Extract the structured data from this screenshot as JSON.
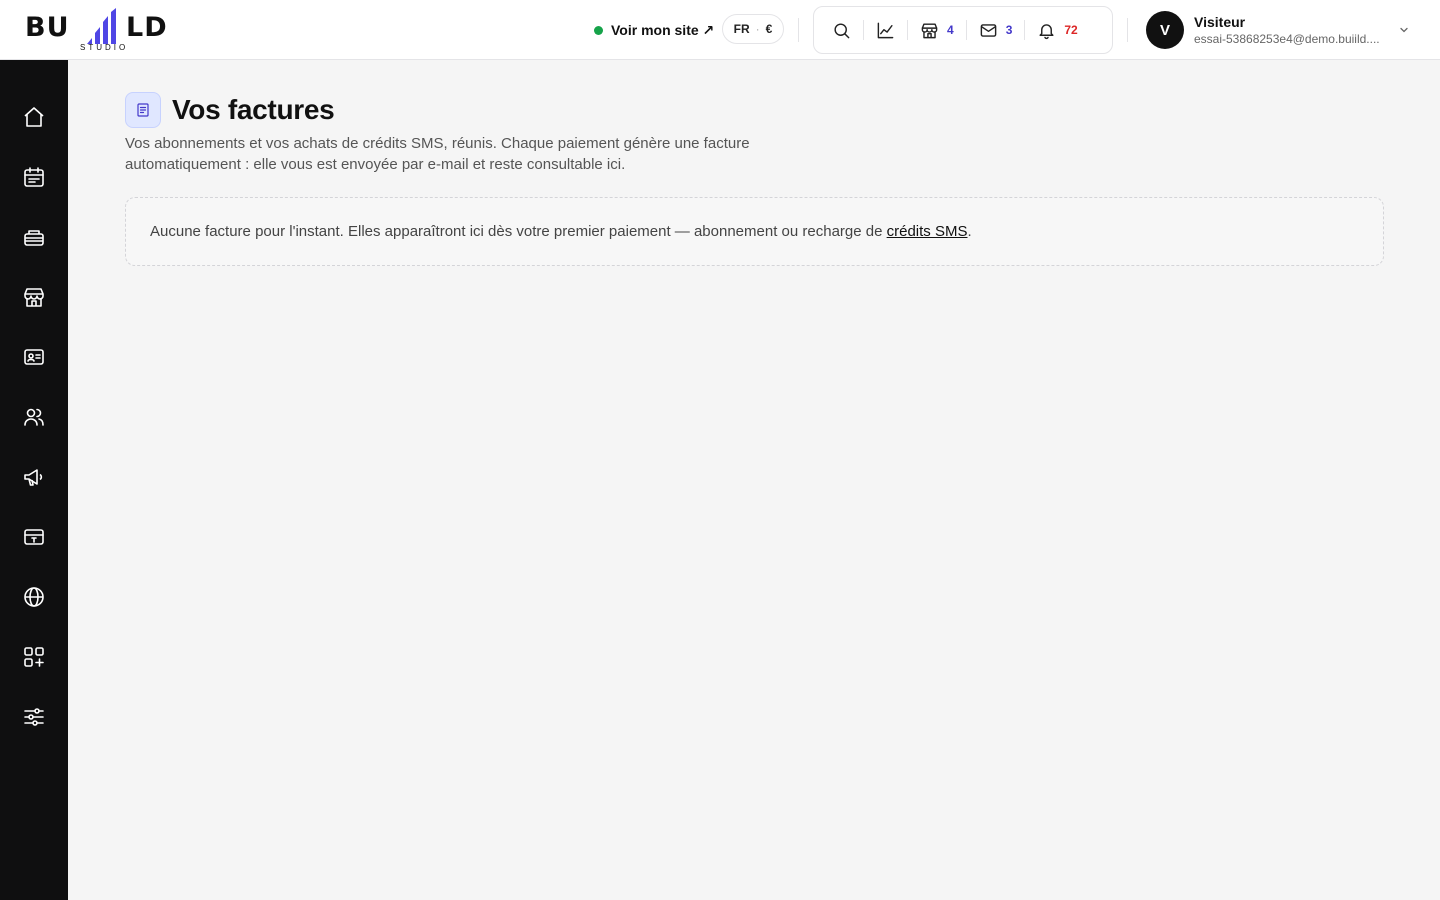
{
  "brand": {
    "word_left": "BU",
    "word_right": "LD",
    "subtitle": "STUDIO",
    "bar_color": "#4f46e5"
  },
  "header": {
    "site_link": "Voir mon site ↗",
    "site_status_color": "#16a34a",
    "language": "FR",
    "currency": "€",
    "tools": [
      {
        "icon": "search-icon"
      },
      {
        "icon": "chart-icon"
      },
      {
        "icon": "store-icon",
        "count": "4"
      },
      {
        "icon": "mail-icon",
        "count": "3"
      },
      {
        "icon": "bell-icon",
        "count": "72",
        "count_color": "#dc2626"
      }
    ]
  },
  "user": {
    "initial": "V",
    "name": "Visiteur",
    "email": "essai-53868253e4@demo.buiild...."
  },
  "sidebar": {
    "items": [
      {
        "icon": "home-icon"
      },
      {
        "icon": "calendar-icon"
      },
      {
        "icon": "services-icon"
      },
      {
        "icon": "store-icon"
      },
      {
        "icon": "contact-card-icon"
      },
      {
        "icon": "users-icon"
      },
      {
        "icon": "megaphone-icon"
      },
      {
        "icon": "payment-card-icon"
      },
      {
        "icon": "globe-icon"
      },
      {
        "icon": "apps-icon"
      },
      {
        "icon": "settings-sliders-icon"
      }
    ]
  },
  "main": {
    "title": "Vos factures",
    "title_icon": "invoice-icon",
    "description": "Vos abonnements et vos achats de crédits SMS, réunis. Chaque paiement génère une facture automatiquement : elle vous est envoyée par e-mail et reste consultable ici.",
    "empty_text": "Aucune facture pour l'instant. Elles apparaîtront ici dès votre premier paiement — abonnement ou recharge de ",
    "empty_link": "crédits SMS",
    "empty_end": "."
  }
}
